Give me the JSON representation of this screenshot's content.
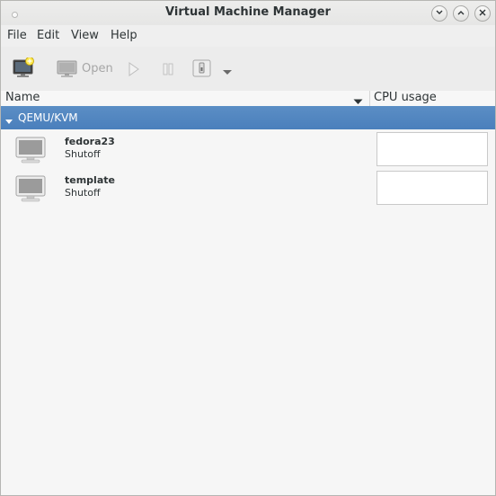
{
  "window": {
    "title": "Virtual Machine Manager"
  },
  "menubar": {
    "items": [
      "File",
      "Edit",
      "View",
      "Help"
    ]
  },
  "toolbar": {
    "open_label": "Open"
  },
  "columns": {
    "name": "Name",
    "cpu_usage": "CPU usage"
  },
  "connections": [
    {
      "name": "QEMU/KVM",
      "vms": [
        {
          "name": "fedora23",
          "status": "Shutoff"
        },
        {
          "name": "template",
          "status": "Shutoff"
        }
      ]
    }
  ],
  "colors": {
    "selection": "#4a7fbc",
    "background": "#f6f6f6"
  },
  "icons": {
    "window": [
      "minimize-icon",
      "maximize-icon",
      "close-icon"
    ],
    "toolbar": [
      "new-vm-icon",
      "monitor-icon",
      "play-icon",
      "pause-icon",
      "shutdown-icon",
      "chevron-down-icon"
    ],
    "vm": "monitor-icon"
  }
}
